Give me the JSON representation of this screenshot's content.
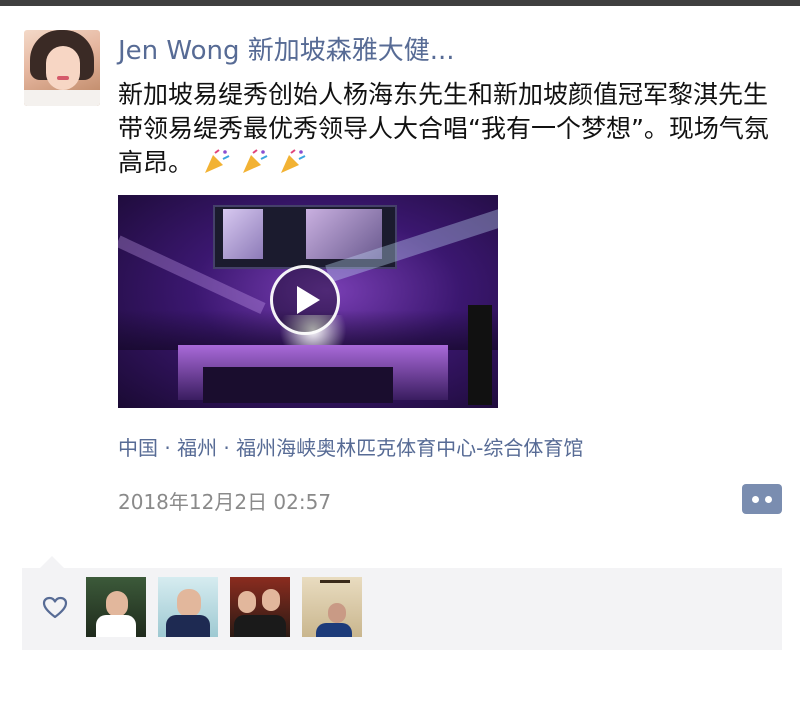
{
  "post": {
    "username": "Jen Wong 新加坡森雅大健...",
    "text": "新加坡易缇秀创始人杨海东先生和新加坡颜值冠军黎淇先生带领易缇秀最优秀领导人大合唱“我有一个梦想”。现场气氛高昂。",
    "emoji": "party-popper-icon",
    "location": "中国 · 福州 · 福州海峡奥林匹克体育中心-综合体育馆",
    "timestamp": "2018年12月2日 02:57"
  },
  "colors": {
    "link": "#576b95",
    "text": "#111111",
    "meta": "#8a8a8a",
    "panel": "#f3f3f5",
    "comment_button": "#7a8db0"
  },
  "likes": {
    "icon": "heart-outline-icon",
    "avatars": [
      "liker-avatar-1",
      "liker-avatar-2",
      "liker-avatar-3",
      "liker-avatar-4"
    ]
  }
}
